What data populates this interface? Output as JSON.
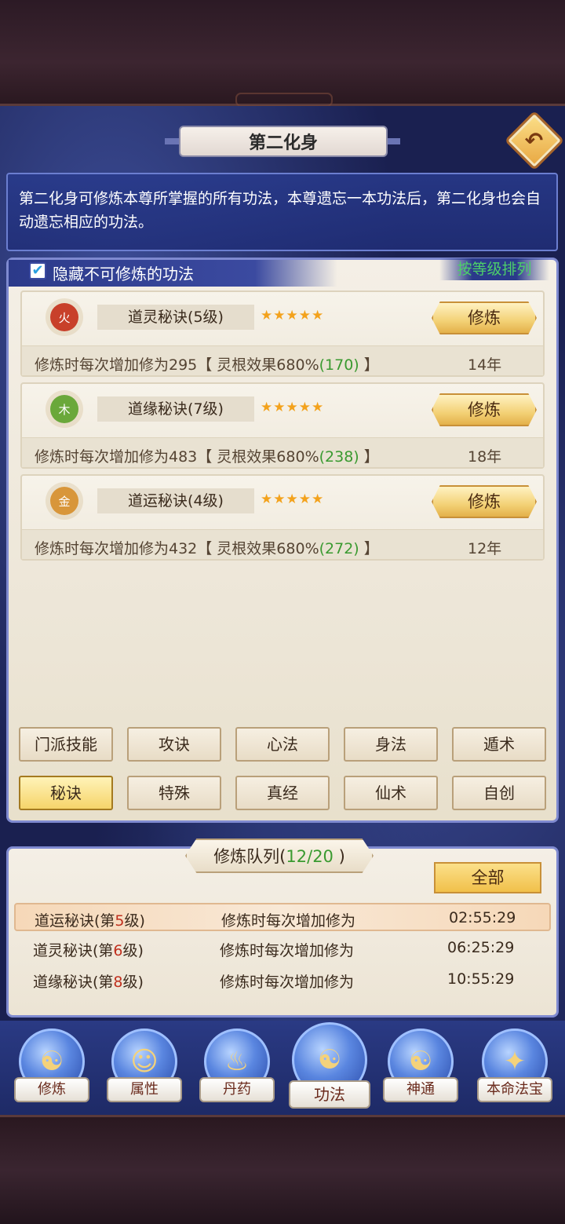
{
  "header": {
    "title": "第二化身",
    "back_icon": "back-arrow-icon"
  },
  "description": "第二化身可修炼本尊所掌握的所有功法，本尊遗忘一本功法后，第二化身也会自动遗忘相应的功法。",
  "filter": {
    "hide_label": "隐藏不可修炼的功法",
    "hide_checked": true,
    "checkmark": "✔",
    "sort_label": "按等级排列"
  },
  "skills": [
    {
      "element": "火",
      "element_color": "#c8402a",
      "name": "道灵秘诀(5级)",
      "stars": "★★★★★",
      "button": "修炼",
      "desc_prefix": "修炼时每次增加修为295【 灵根效果680%",
      "desc_green": "(170)",
      "desc_suffix": " 】",
      "years": "14年"
    },
    {
      "element": "木",
      "element_color": "#6aa83a",
      "name": "道缘秘诀(7级)",
      "stars": "★★★★★",
      "button": "修炼",
      "desc_prefix": "修炼时每次增加修为483【 灵根效果680%",
      "desc_green": "(238)",
      "desc_suffix": " 】",
      "years": "18年"
    },
    {
      "element": "金",
      "element_color": "#d8963a",
      "name": "道运秘诀(4级)",
      "stars": "★★★★★",
      "button": "修炼",
      "desc_prefix": "修炼时每次增加修为432【 灵根效果680%",
      "desc_green": "(272)",
      "desc_suffix": " 】",
      "years": "12年"
    }
  ],
  "categories": {
    "row1": [
      "门派技能",
      "攻诀",
      "心法",
      "身法",
      "遁术"
    ],
    "row2": [
      "秘诀",
      "特殊",
      "真经",
      "仙术",
      "自创"
    ],
    "active": "秘诀"
  },
  "queue": {
    "title_prefix": "修炼队列(",
    "count": "12/20",
    "title_suffix": " )",
    "all_button": "全部",
    "rows": [
      {
        "name_prefix": "道运秘诀(第",
        "level": "5",
        "name_suffix": "级)",
        "desc": "修炼时每次增加修为",
        "time": "02:55:29"
      },
      {
        "name_prefix": "道灵秘诀(第",
        "level": "6",
        "name_suffix": "级)",
        "desc": "修炼时每次增加修为",
        "time": "06:25:29"
      },
      {
        "name_prefix": "道缘秘诀(第",
        "level": "8",
        "name_suffix": "级)",
        "desc": "修炼时每次增加修为",
        "time": "10:55:29"
      }
    ]
  },
  "nav": [
    {
      "label": "修炼",
      "icon": "meditation-icon",
      "glyph": "☯"
    },
    {
      "label": "属性",
      "icon": "character-icon",
      "glyph": "☺"
    },
    {
      "label": "丹药",
      "icon": "pill-furnace-icon",
      "glyph": "♨"
    },
    {
      "label": "功法",
      "icon": "scroll-icon",
      "glyph": "☯",
      "active": true
    },
    {
      "label": "神通",
      "icon": "book-icon",
      "glyph": "☯"
    },
    {
      "label": "本命法宝",
      "icon": "treasure-icon",
      "glyph": "✦"
    }
  ]
}
